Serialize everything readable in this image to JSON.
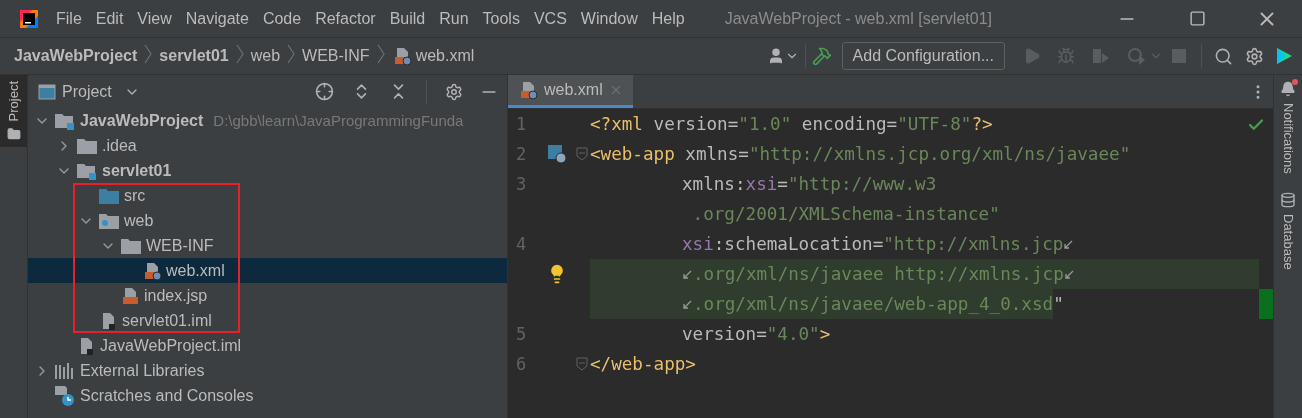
{
  "window": {
    "title": "JavaWebProject - web.xml [servlet01]",
    "menu": [
      "File",
      "Edit",
      "View",
      "Navigate",
      "Code",
      "Refactor",
      "Build",
      "Run",
      "Tools",
      "VCS",
      "Window",
      "Help"
    ]
  },
  "breadcrumbs": [
    {
      "label": "JavaWebProject",
      "bold": true,
      "file_icon": false
    },
    {
      "label": "servlet01",
      "bold": true,
      "file_icon": false
    },
    {
      "label": "web",
      "bold": false,
      "file_icon": false
    },
    {
      "label": "WEB-INF",
      "bold": false,
      "file_icon": false
    },
    {
      "label": "web.xml",
      "bold": false,
      "file_icon": true
    }
  ],
  "toolbar": {
    "configuration": "Add Configuration..."
  },
  "left_strip": {
    "label": "Project"
  },
  "project_panel": {
    "title": "Project",
    "tree": [
      {
        "label": "JavaWebProject",
        "kind": "module",
        "bold": true,
        "hint": "D:\\gbb\\learn\\JavaProgrammingFunda",
        "expanded": true,
        "selected": false,
        "children": [
          {
            "label": ".idea",
            "kind": "folder",
            "expanded": false,
            "selected": false
          },
          {
            "label": "servlet01",
            "kind": "module",
            "bold": true,
            "expanded": true,
            "selected": false,
            "boxed": true,
            "children": [
              {
                "label": "src",
                "kind": "source-folder",
                "selected": false
              },
              {
                "label": "web",
                "kind": "web-folder",
                "expanded": true,
                "selected": false,
                "children": [
                  {
                    "label": "WEB-INF",
                    "kind": "folder",
                    "expanded": true,
                    "selected": false,
                    "children": [
                      {
                        "label": "web.xml",
                        "kind": "xml-file",
                        "selected": true
                      }
                    ]
                  },
                  {
                    "label": "index.jsp",
                    "kind": "jsp-file",
                    "selected": false
                  }
                ]
              },
              {
                "label": "servlet01.iml",
                "kind": "iml-file",
                "selected": false
              }
            ]
          },
          {
            "label": "JavaWebProject.iml",
            "kind": "iml-file",
            "selected": false
          }
        ]
      },
      {
        "label": "External Libraries",
        "kind": "libraries",
        "expanded": false,
        "selected": false
      },
      {
        "label": "Scratches and Consoles",
        "kind": "scratches",
        "selected": false
      }
    ]
  },
  "editor": {
    "tabs": [
      {
        "label": "web.xml",
        "selected": true
      }
    ],
    "lines": [
      {
        "number": "1",
        "tokens": [
          {
            "t": "<?xml",
            "kind": "tag"
          },
          {
            "t": " version=",
            "kind": "attr"
          },
          {
            "t": "\"1.0\"",
            "kind": "value"
          },
          {
            "t": " encoding=",
            "kind": "attr"
          },
          {
            "t": "\"UTF-8\"",
            "kind": "value"
          },
          {
            "t": "?>",
            "kind": "tag"
          }
        ]
      },
      {
        "number": "2",
        "web_icon": true,
        "fold": true,
        "tokens": [
          {
            "t": "<web-app",
            "kind": "tag"
          },
          {
            "t": " xmlns=",
            "kind": "attr"
          },
          {
            "t": "\"http://xmlns.jcp.org/xml/ns/javaee\"",
            "kind": "value"
          }
        ]
      },
      {
        "number": "3",
        "indented": true,
        "tokens": [
          {
            "t": "xmlns:",
            "kind": "attr"
          },
          {
            "t": "xsi",
            "kind": "ns"
          },
          {
            "t": "=",
            "kind": "attr"
          },
          {
            "t": "\"http://www.w3",
            "kind": "value"
          }
        ]
      },
      {
        "indented": true,
        "tokens": [
          {
            "t": " .org/2001/XMLSchema-instance\"",
            "kind": "value"
          }
        ]
      },
      {
        "number": "4",
        "indented": true,
        "wrap_after": true,
        "tokens": [
          {
            "t": "xsi",
            "kind": "ns"
          },
          {
            "t": ":schemaLocation=",
            "kind": "attr"
          },
          {
            "t": "\"http://xmlns.jcp",
            "kind": "value"
          }
        ]
      },
      {
        "indented": true,
        "wrap_before": true,
        "wrap_after": true,
        "bulb": true,
        "highlighted": true,
        "tokens": [
          {
            "t": ".org/xml/ns/javaee http://xmlns.jcp",
            "kind": "value"
          }
        ]
      },
      {
        "indented": true,
        "wrap_before": true,
        "change_marker": true,
        "tokens": [
          {
            "t": ".org/xml/ns/javaee/web-app_4_0.xsd",
            "kind": "value",
            "marked": true
          },
          {
            "t": "\"",
            "kind": "attr"
          }
        ]
      },
      {
        "number": "5",
        "indented": true,
        "tokens": [
          {
            "t": "version=",
            "kind": "attr"
          },
          {
            "t": "\"4.0\"",
            "kind": "value"
          },
          {
            "t": ">",
            "kind": "tag"
          }
        ]
      },
      {
        "number": "6",
        "fold": true,
        "tokens": [
          {
            "t": "</web-app>",
            "kind": "tag"
          }
        ]
      }
    ]
  },
  "right_strip": [
    {
      "label": "Notifications",
      "kind": "notifications"
    },
    {
      "label": "Database",
      "kind": "database"
    }
  ]
}
